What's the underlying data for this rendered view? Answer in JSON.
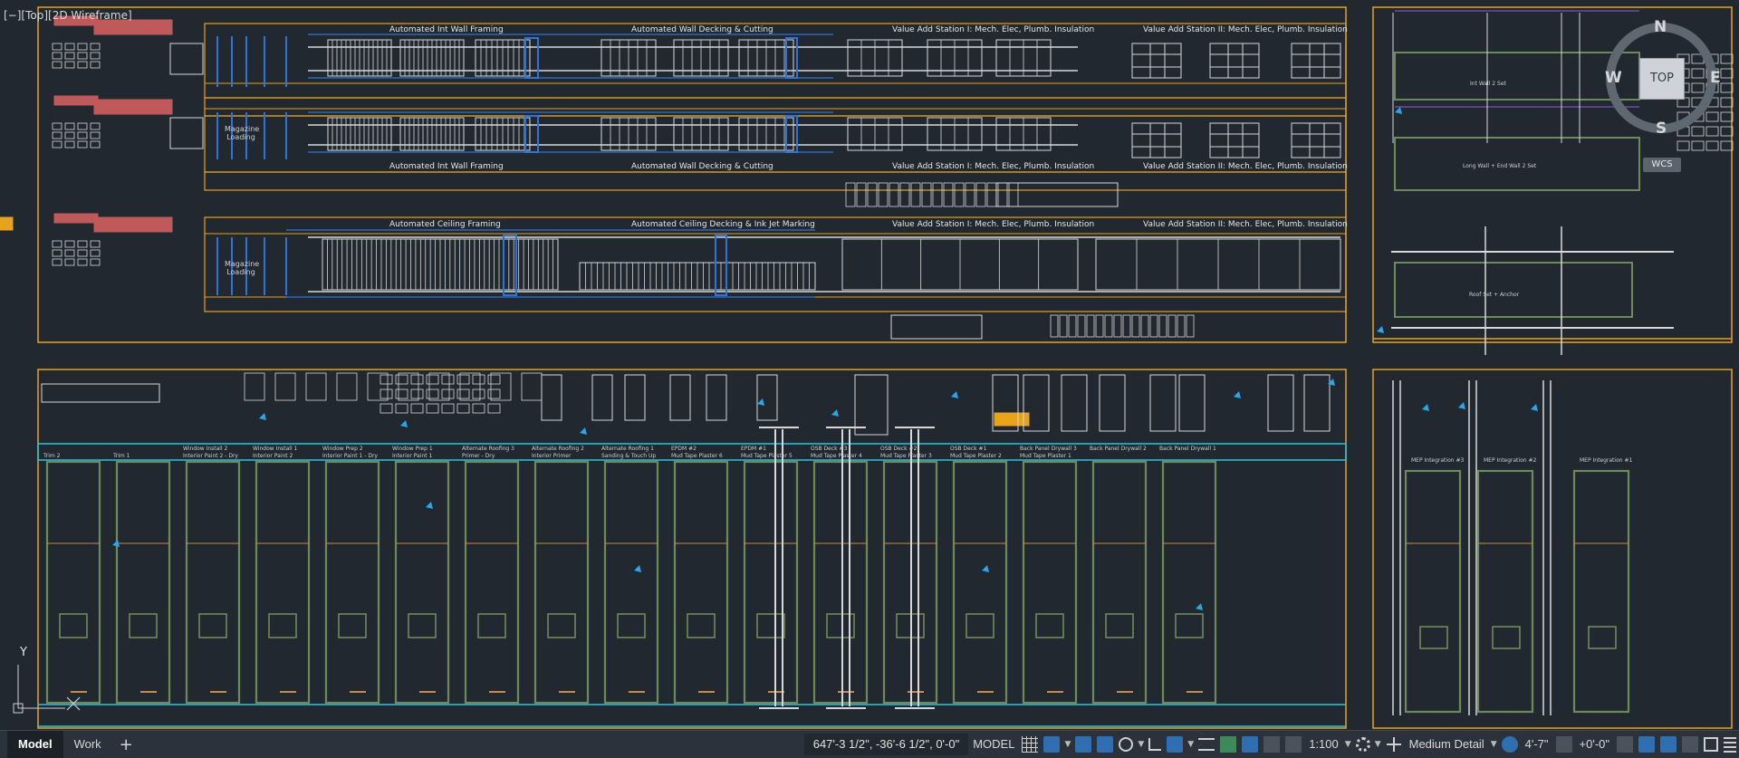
{
  "viewport": {
    "label": "[−][Top][2D Wireframe]"
  },
  "top_section": {
    "row1": [
      "Automated Int Wall Framing",
      "Automated Wall Decking & Cutting",
      "Value Add Station I: Mech. Elec, Plumb. Insulation",
      "Value Add Station II: Mech. Elec, Plumb. Insulation"
    ],
    "row2": [
      "Automated Int Wall Framing",
      "Automated Wall Decking & Cutting",
      "Value Add Station I: Mech. Elec, Plumb. Insulation",
      "Value Add Station II: Mech. Elec, Plumb. Insulation"
    ],
    "row3": [
      "Automated Ceiling Framing",
      "Automated Ceiling Decking & Ink Jet Marking",
      "Value Add Station I: Mech. Elec, Plumb. Insulation",
      "Value Add Station II: Mech. Elec, Plumb. Insulation"
    ],
    "magazine_1": "Magazine Loading",
    "magazine_2": "Magazine Loading"
  },
  "right_plan": {
    "room1": "Int Wall 2 Set",
    "room2": "Long Wall + End Wall 2 Set",
    "room3": "Roof Set + Anchor"
  },
  "bays": {
    "row_top": [
      "",
      "",
      "Window Install 2",
      "Window Install 1",
      "Window Prep 2",
      "Window Prep 1",
      "Alternate Roofing 3",
      "Alternate Roofing 2",
      "Alternate Roofing 1",
      "EPDM #2",
      "EPDM #1",
      "OSB Deck #3",
      "OSB Deck #2",
      "OSB Deck #1",
      "Back Panel Drywall 3",
      "Back Panel Drywall 2",
      "Back Panel Drywall 1"
    ],
    "row_bottom": [
      "Trim 2",
      "Trim 1",
      "Interior Paint 2 - Dry",
      "Interior Paint 2",
      "Interior Paint 1 - Dry",
      "Interior Paint 1",
      "Primer - Dry",
      "Interior Primer",
      "Sanding & Touch Up",
      "Mud Tape Plaster 6",
      "Mud Tape Plaster 5",
      "Mud Tape Plaster 4",
      "Mud Tape Plaster 3",
      "Mud Tape Plaster 2",
      "Mud Tape Plaster 1",
      "",
      ""
    ],
    "mep": [
      "MEP Integration #3",
      "MEP Integration #2",
      "MEP Integration #1"
    ]
  },
  "viewcube": {
    "n": "N",
    "s": "S",
    "e": "E",
    "w": "W",
    "top": "TOP",
    "wcs": "WCS"
  },
  "ucs": {
    "y": "Y"
  },
  "statusbar": {
    "tabs": [
      "Model",
      "Work"
    ],
    "add": "+",
    "coords": "647'-3 1/2\", -36'-6 1/2\", 0'-0\"",
    "mode": "MODEL",
    "scale": "1:100",
    "detail": "Medium Detail",
    "elevation": "4'-7\"",
    "offset": "+0'-0\""
  },
  "colors": {
    "background": "#212830",
    "orange": "#e8a21c",
    "cyan": "#2cc4e0",
    "blue": "#2f73d6",
    "green": "#6f8a5a",
    "red": "#c05a5a"
  }
}
